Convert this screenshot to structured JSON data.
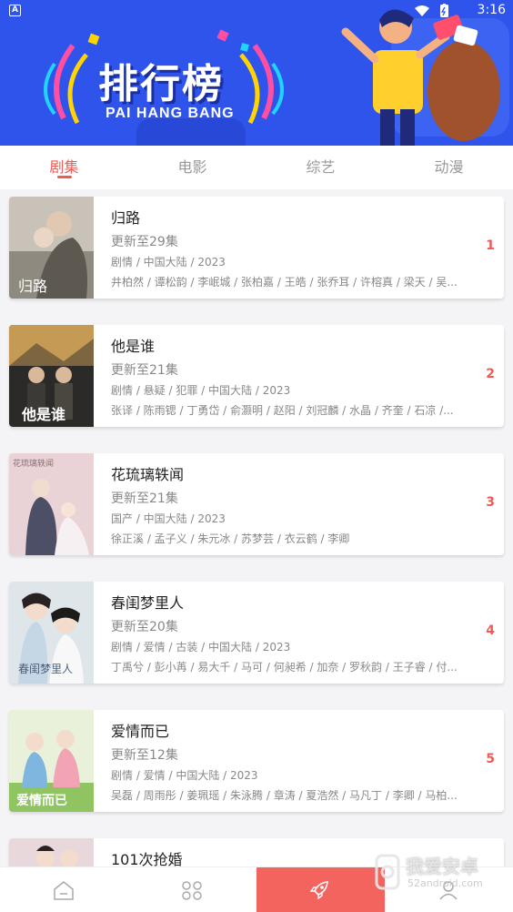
{
  "status_bar": {
    "time": "3:16",
    "badge": "A"
  },
  "banner": {
    "title": "排行榜",
    "subtitle": "PAI HANG BANG"
  },
  "tabs": [
    {
      "label": "剧集",
      "active": true
    },
    {
      "label": "电影",
      "active": false
    },
    {
      "label": "综艺",
      "active": false
    },
    {
      "label": "动漫",
      "active": false
    }
  ],
  "items": [
    {
      "title": "归路",
      "update": "更新至29集",
      "tags": "剧情 / 中国大陆 / 2023",
      "cast": "井柏然 / 谭松韵 / 李岷城 / 张柏嘉 / 王皓 / 张乔耳 / 许榕真 / 梁天 / 吴...",
      "rank": "1",
      "poster_text": "归路"
    },
    {
      "title": "他是谁",
      "update": "更新至21集",
      "tags": "剧情 / 悬疑 / 犯罪 / 中国大陆 / 2023",
      "cast": "张译 / 陈雨锶 / 丁勇岱 / 俞灏明 / 赵阳 / 刘冠麟 / 水晶 / 齐奎 / 石凉 /...",
      "rank": "2",
      "poster_text": "他是谁"
    },
    {
      "title": "花琉璃轶闻",
      "update": "更新至21集",
      "tags": "国产 / 中国大陆 / 2023",
      "cast": "徐正溪 / 孟子义 / 朱元冰 / 苏梦芸 / 衣云鹤 / 李卿",
      "rank": "3",
      "poster_text": "花琉璃轶闻"
    },
    {
      "title": "春闺梦里人",
      "update": "更新至20集",
      "tags": "剧情 / 爱情 / 古装 / 中国大陆 / 2023",
      "cast": "丁禹兮 / 彭小苒 / 易大千 / 马可 / 何昶希 / 加奈 / 罗秋韵 / 王子睿 / 付...",
      "rank": "4",
      "poster_text": "春闺梦里人"
    },
    {
      "title": "爱情而已",
      "update": "更新至12集",
      "tags": "剧情 / 爱情 / 中国大陆 / 2023",
      "cast": "吴磊 / 周雨彤 / 姜珮瑶 / 朱泳腾 / 章涛 / 夏浩然 / 马凡丁 / 李卿 / 马柏...",
      "rank": "5",
      "poster_text": "爱情而已"
    },
    {
      "title": "101次抢婚",
      "update": "",
      "tags": "",
      "cast": "",
      "rank": "",
      "poster_text": ""
    }
  ],
  "bottom_nav": [
    {
      "icon": "home-icon",
      "active": false
    },
    {
      "icon": "grid-icon",
      "active": false
    },
    {
      "icon": "rocket-icon",
      "active": true
    },
    {
      "icon": "user-icon",
      "active": false
    }
  ],
  "watermark": {
    "text": "我爱安卓",
    "url": "52android.com"
  },
  "colors": {
    "accent": "#ef5a55",
    "banner": "#2f54eb",
    "nav_active": "#f4645f"
  }
}
